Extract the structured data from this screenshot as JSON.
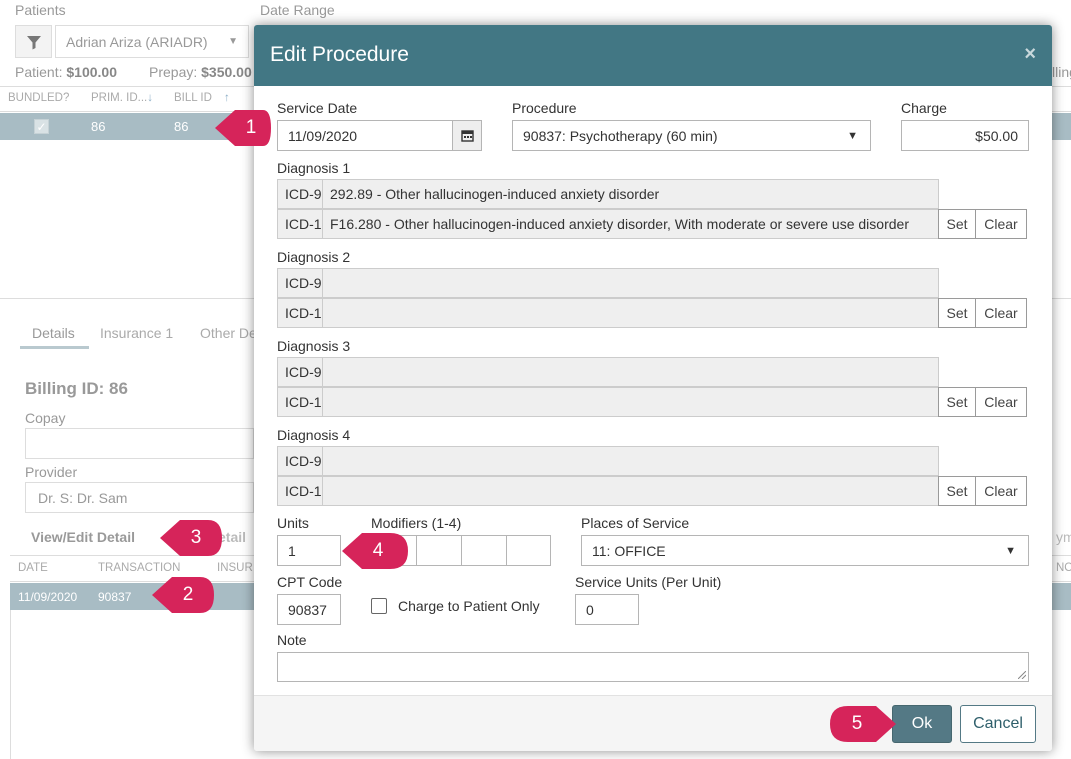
{
  "background": {
    "patients_label": "Patients",
    "patient_select_value": "Adrian Ariza (ARIADR)",
    "date_range_label": "Date Range",
    "patient_balance_label": "Patient:",
    "patient_balance_value": "$100.00",
    "prepay_label": "Prepay:",
    "prepay_value": "$350.00",
    "billing_truncated": "lling",
    "table_headers": [
      "BUNDLED?",
      "PRIM. ID...",
      "BILL ID"
    ],
    "table_row": {
      "prim_id": "86",
      "bill_id": "86"
    },
    "tabs": [
      "Details",
      "Insurance 1",
      "Other De"
    ],
    "billing_id": "Billing ID: 86",
    "copay_label": "Copay",
    "provider_label": "Provider",
    "provider_value": "Dr. S: Dr. Sam",
    "view_edit_detail": "View/Edit Detail",
    "detail_truncated": "etail",
    "paym_truncated": "ym",
    "trans_headers": [
      "DATE",
      "TRANSACTION",
      "INSUR"
    ],
    "trans_row": {
      "date": "11/09/2020",
      "transaction": "90837"
    },
    "no_truncated": "NO"
  },
  "modal": {
    "title": "Edit Procedure",
    "close": "×",
    "service_date_label": "Service Date",
    "service_date_value": "11/09/2020",
    "procedure_label": "Procedure",
    "procedure_value": "90837: Psychotherapy (60 min)",
    "charge_label": "Charge",
    "charge_value": "$50.00",
    "diagnoses": [
      {
        "label": "Diagnosis 1",
        "icd9_prefix": "ICD-9",
        "icd9_text": "292.89 - Other hallucinogen-induced anxiety disorder",
        "icd10_prefix": "ICD-1",
        "icd10_text": "F16.280 - Other hallucinogen-induced anxiety disorder, With moderate or severe use disorder"
      },
      {
        "label": "Diagnosis 2",
        "icd9_prefix": "ICD-9",
        "icd9_text": "",
        "icd10_prefix": "ICD-1",
        "icd10_text": ""
      },
      {
        "label": "Diagnosis 3",
        "icd9_prefix": "ICD-9",
        "icd9_text": "",
        "icd10_prefix": "ICD-1",
        "icd10_text": ""
      },
      {
        "label": "Diagnosis 4",
        "icd9_prefix": "ICD-9",
        "icd9_text": "",
        "icd10_prefix": "ICD-1",
        "icd10_text": ""
      }
    ],
    "set_label": "Set",
    "clear_label": "Clear",
    "units_label": "Units",
    "units_value": "1",
    "modifiers_label": "Modifiers (1-4)",
    "pos_label": "Places of Service",
    "pos_value": "11: OFFICE",
    "cpt_label": "CPT Code",
    "cpt_value": "90837",
    "charge_to_patient_label": "Charge to Patient Only",
    "charge_to_patient_checked": false,
    "service_units_label": "Service Units (Per Unit)",
    "service_units_value": "0",
    "note_label": "Note",
    "note_value": "",
    "ok_label": "Ok",
    "cancel_label": "Cancel"
  },
  "callouts": [
    "1",
    "2",
    "3",
    "4",
    "5"
  ],
  "colors": {
    "header": "#427784",
    "callout": "#d6245a",
    "selected_row": "#a8bcc4",
    "ok_button": "#547985"
  }
}
